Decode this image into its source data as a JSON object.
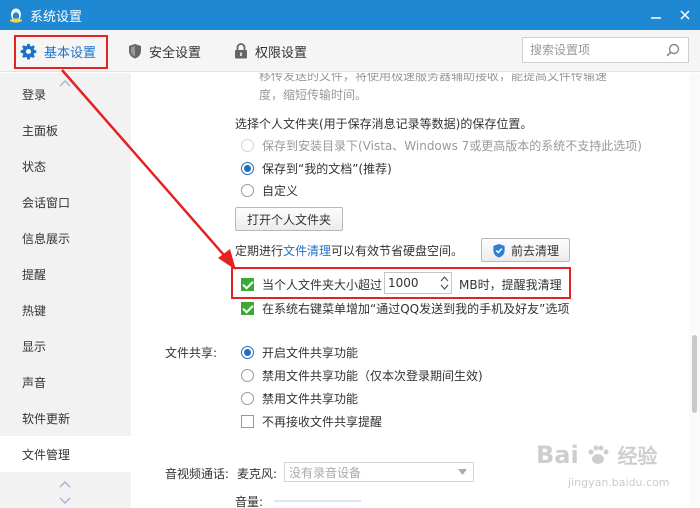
{
  "window": {
    "title": "系统设置",
    "colors": {
      "titlebar": "#1e88d2",
      "accent": "#1a73c8",
      "highlight": "#e52222",
      "check": "#3aaa35"
    }
  },
  "tabs": [
    {
      "label": "基本设置",
      "icon": "gear-icon"
    },
    {
      "label": "安全设置",
      "icon": "shield-icon"
    },
    {
      "label": "权限设置",
      "icon": "lock-icon"
    }
  ],
  "search": {
    "placeholder": "搜索设置项",
    "value": ""
  },
  "sidebar": {
    "items": [
      {
        "label": "登录"
      },
      {
        "label": "主面板"
      },
      {
        "label": "状态"
      },
      {
        "label": "会话窗口"
      },
      {
        "label": "信息展示"
      },
      {
        "label": "提醒"
      },
      {
        "label": "热键"
      },
      {
        "label": "显示"
      },
      {
        "label": "声音"
      },
      {
        "label": "软件更新"
      },
      {
        "label": "文件管理"
      }
    ],
    "active": "文件管理"
  },
  "content": {
    "top_partial_line1": "移传发送的文件，将使用极速服务器辅助接收，能提高文件传输速",
    "top_partial_line2": "度，缩短传输时间。",
    "save_location": {
      "heading": "选择个人文件夹(用于保存消息记录等数据)的保存位置。",
      "options": [
        {
          "label": "保存到安装目录下(Vista、Windows 7或更高版本的系统不支持此选项)",
          "state": "disabled"
        },
        {
          "label": "保存到“我的文档”(推荐)",
          "state": "selected"
        },
        {
          "label": "自定义",
          "state": "unselected"
        }
      ],
      "open_folder_button": "打开个人文件夹"
    },
    "cleanup": {
      "text_prefix": "定期进行",
      "link": "文件清理",
      "text_suffix": "可以有效节省硬盘空间。",
      "button": "前去清理",
      "size_check_label": "当个人文件夹大小超过",
      "size_value": "1000",
      "size_unit_text": "MB时，提醒我清理",
      "context_menu_label": "在系统右键菜单增加“通过QQ发送到我的手机及好友”选项"
    },
    "file_sharing": {
      "label": "文件共享:",
      "options": [
        {
          "label": "开启文件共享功能",
          "state": "selected"
        },
        {
          "label": "禁用文件共享功能（仅本次登录期间生效)",
          "state": "unselected"
        },
        {
          "label": "禁用文件共享功能",
          "state": "unselected"
        }
      ],
      "no_reminder_label": "不再接收文件共享提醒"
    },
    "av_call": {
      "label": "音视频通话:",
      "mic_label": "麦克风:",
      "mic_value": "没有录音设备",
      "volume_label": "音量:"
    }
  },
  "watermark": {
    "brand": "Bai",
    "brand_suffix": "经验",
    "url": "jingyan.baidu.com"
  }
}
